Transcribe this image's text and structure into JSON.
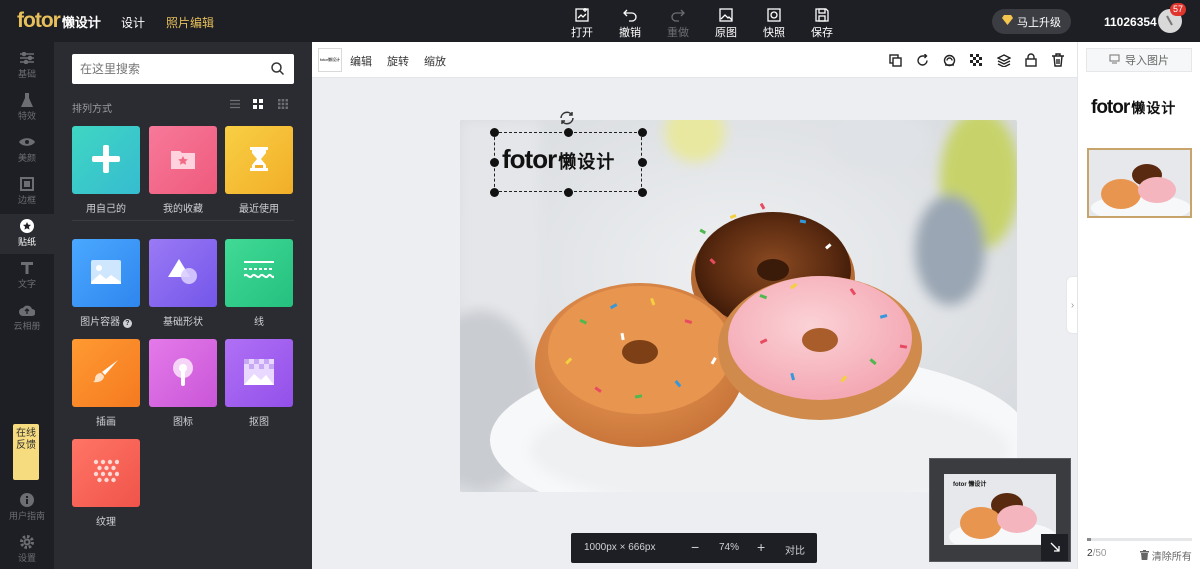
{
  "header": {
    "logo": "fotor",
    "logo_cn": "懒设计",
    "nav": [
      "设计",
      "照片编辑"
    ],
    "tools": [
      {
        "label": "打开",
        "icon": "open-icon",
        "enabled": true
      },
      {
        "label": "撤销",
        "icon": "undo-icon",
        "enabled": true
      },
      {
        "label": "重做",
        "icon": "redo-icon",
        "enabled": false
      },
      {
        "label": "原图",
        "icon": "original-icon",
        "enabled": true
      },
      {
        "label": "快照",
        "icon": "snapshot-icon",
        "enabled": true
      },
      {
        "label": "保存",
        "icon": "save-icon",
        "enabled": true
      }
    ],
    "upgrade_label": "马上升级",
    "user_id": "11026354",
    "notification_count": "57"
  },
  "sidebar": {
    "items": [
      {
        "label": "基础",
        "icon": "sliders-icon"
      },
      {
        "label": "特效",
        "icon": "flask-icon"
      },
      {
        "label": "美颜",
        "icon": "eye-icon"
      },
      {
        "label": "边框",
        "icon": "frame-icon"
      },
      {
        "label": "贴纸",
        "icon": "sticker-icon",
        "active": true
      },
      {
        "label": "文字",
        "icon": "text-icon"
      },
      {
        "label": "云相册",
        "icon": "cloud-icon"
      }
    ],
    "feedback": "在线反馈",
    "bottom": [
      {
        "label": "用户指南",
        "icon": "info-icon"
      },
      {
        "label": "设置",
        "icon": "gear-icon"
      }
    ]
  },
  "panel": {
    "search_placeholder": "在这里搜索",
    "sort_label": "排列方式",
    "tiles": [
      {
        "label": "用自己的",
        "icon": "plus-icon",
        "color": "#3ccfbf"
      },
      {
        "label": "我的收藏",
        "icon": "folder-star-icon",
        "color": "#f26a86"
      },
      {
        "label": "最近使用",
        "icon": "hourglass-icon",
        "color": "#f5c23a"
      },
      {
        "label": "图片容器",
        "icon": "image-icon",
        "color": "#3f97f5",
        "help": true
      },
      {
        "label": "基础形状",
        "icon": "shapes-icon",
        "color": "#8a6cf0"
      },
      {
        "label": "线",
        "icon": "lines-icon",
        "color": "#36d18f"
      },
      {
        "label": "插画",
        "icon": "brush-icon",
        "color": "#f98a2c"
      },
      {
        "label": "图标",
        "icon": "pin-icon",
        "color": "#d86ae0"
      },
      {
        "label": "抠图",
        "icon": "cutout-icon",
        "color": "#a560f0"
      },
      {
        "label": "纹理",
        "icon": "dots-icon",
        "color": "#f4655a"
      }
    ]
  },
  "toolbar": {
    "thumb_text": "fotor懒设计",
    "actions": [
      "编辑",
      "旋转",
      "缩放"
    ],
    "right_icons": [
      "duplicate-icon",
      "rotate-icon",
      "color-icon",
      "transparency-icon",
      "layers-icon",
      "lock-icon",
      "delete-icon"
    ]
  },
  "canvas": {
    "sticker_logo": "fotor",
    "sticker_cn": "懒设计",
    "size": "1000px × 666px",
    "zoom": "74%",
    "compare": "对比"
  },
  "right_panel": {
    "import_label": "导入图片",
    "logo": "fotor",
    "logo_cn": "懒设计",
    "count": "2",
    "count_total": "/50",
    "progress": 0.04,
    "clear_label": "清除所有"
  }
}
